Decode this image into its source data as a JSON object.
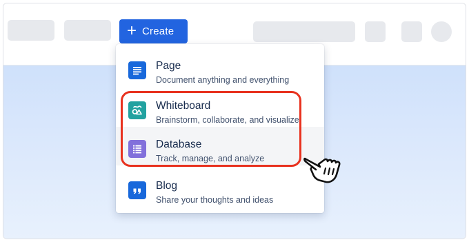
{
  "topbar": {
    "create_label": "Create"
  },
  "menu": {
    "items": [
      {
        "title": "Page",
        "description": "Document anything and everything",
        "icon": "page-icon",
        "color": "#1868db"
      },
      {
        "title": "Whiteboard",
        "description": "Brainstorm, collaborate, and visualize",
        "icon": "whiteboard-icon",
        "color": "#22a2a0"
      },
      {
        "title": "Database",
        "description": "Track, manage, and analyze",
        "icon": "database-icon",
        "color": "#8270db"
      },
      {
        "title": "Blog",
        "description": "Share your thoughts and ideas",
        "icon": "quote-icon",
        "color": "#1868db"
      }
    ]
  },
  "colors": {
    "accent": "#2264e0",
    "highlight": "#e8321f"
  }
}
